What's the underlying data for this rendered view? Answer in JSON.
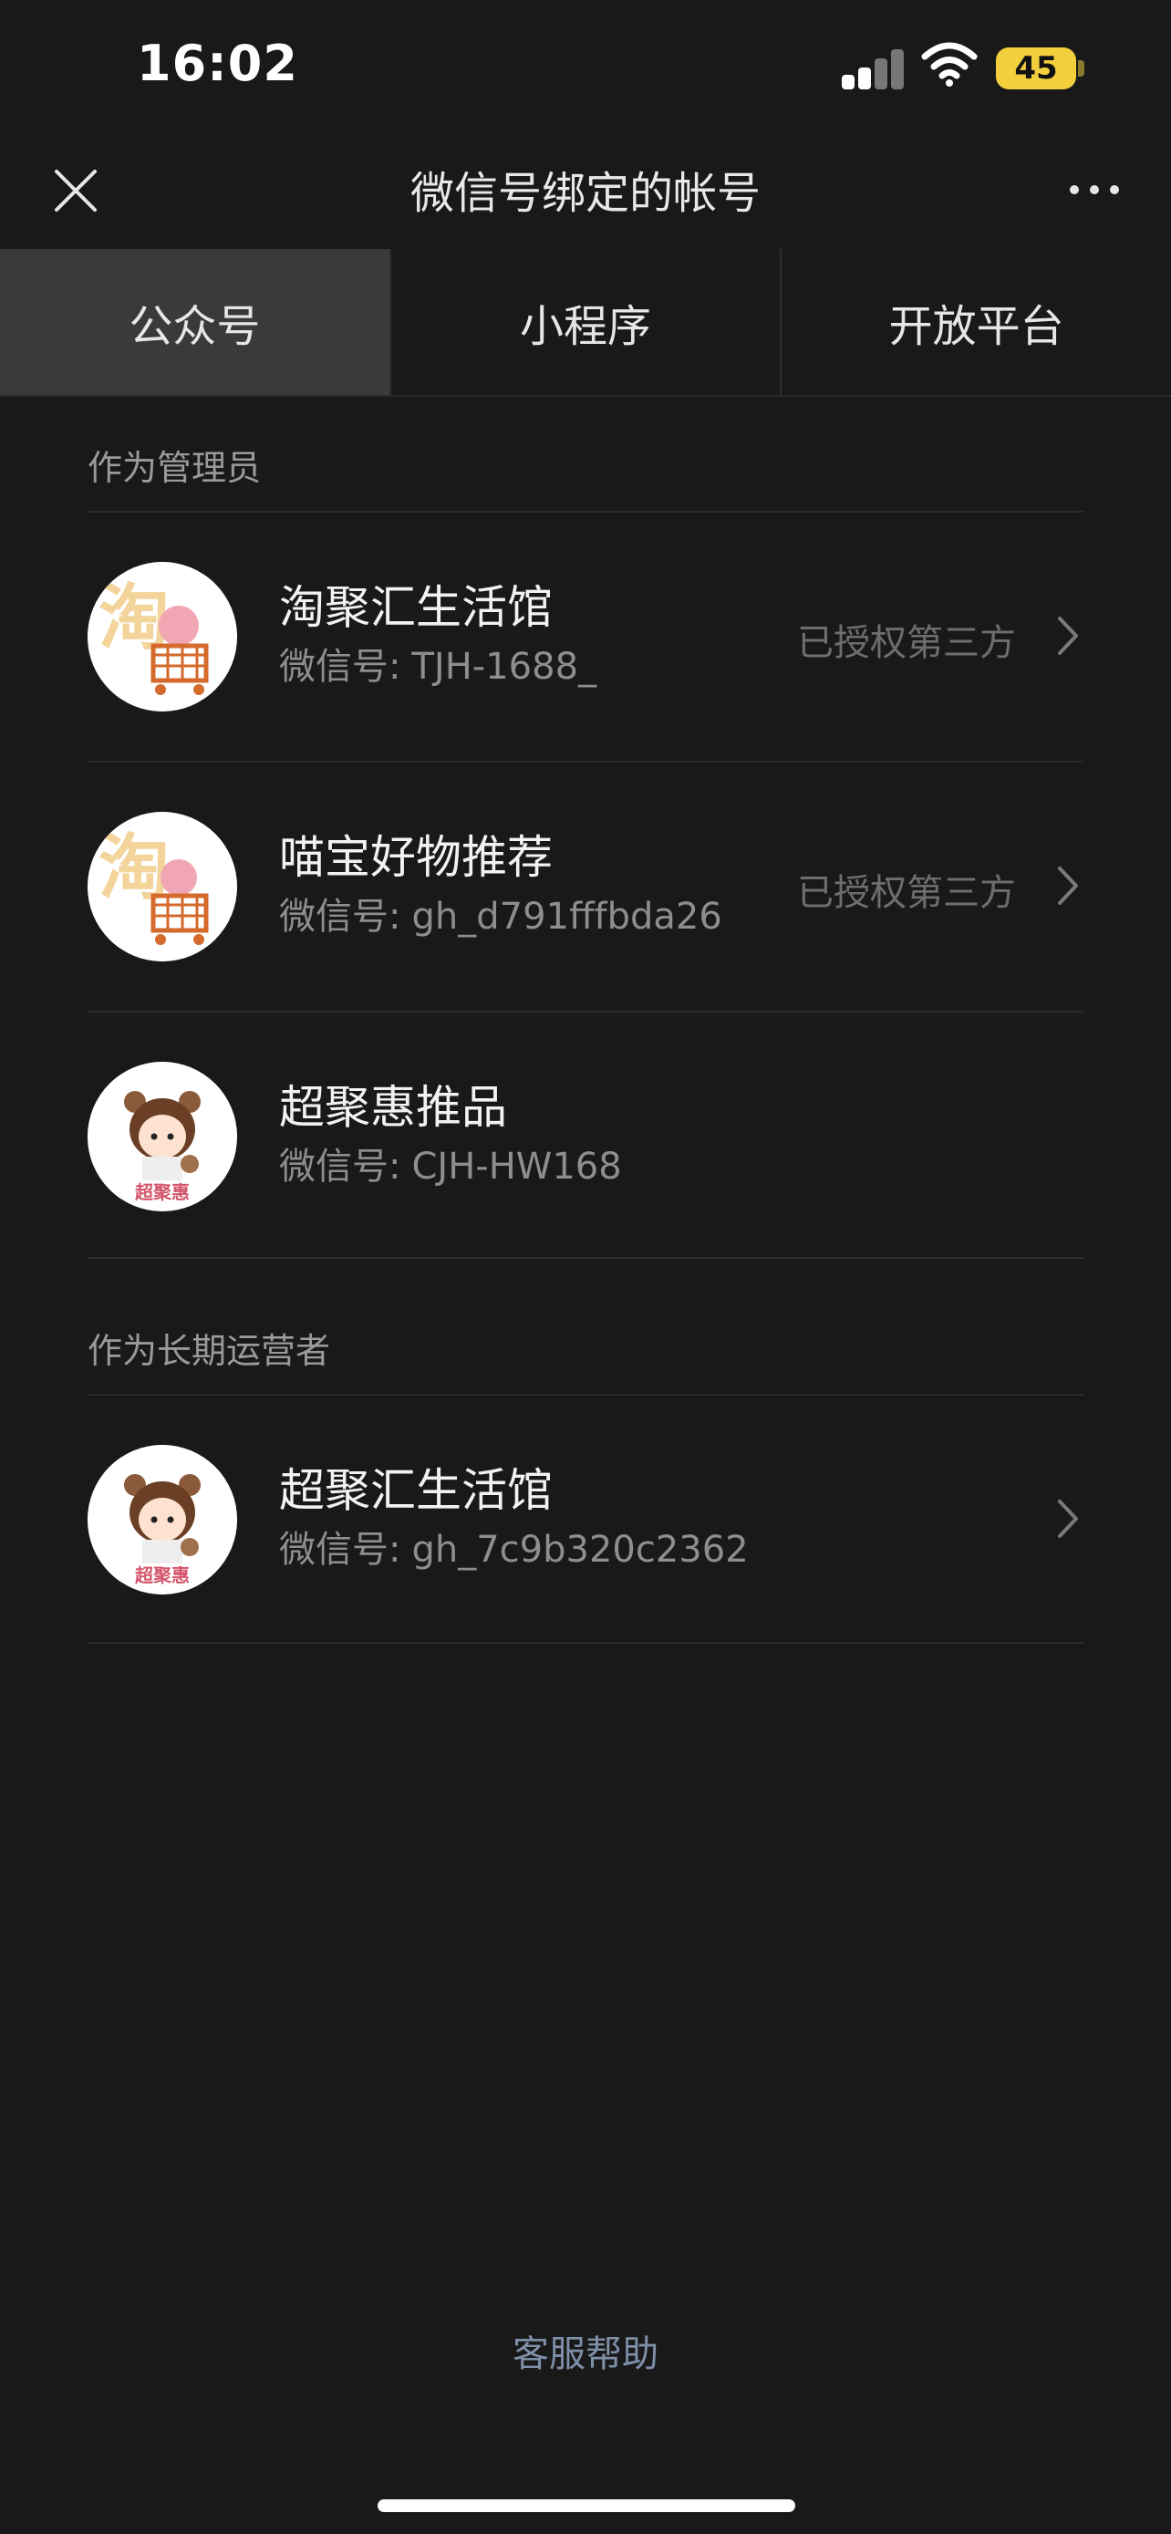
{
  "status_bar": {
    "time": "16:02",
    "battery": "45"
  },
  "nav": {
    "title": "微信号绑定的帐号"
  },
  "tabs": [
    {
      "label": "公众号",
      "active": true
    },
    {
      "label": "小程序",
      "active": false
    },
    {
      "label": "开放平台",
      "active": false
    }
  ],
  "sections": [
    {
      "header": "作为管理员",
      "items": [
        {
          "name": "淘聚汇生活馆",
          "id_label": "微信号:",
          "id": "TJH-1688_",
          "status": "已授权第三方",
          "avatar": "tao-cart-logo"
        },
        {
          "name": "喵宝好物推荐",
          "id_label": "微信号:",
          "id": "gh_d791fffbda26",
          "status": "已授权第三方",
          "avatar": "tao-cart-logo"
        },
        {
          "name": "超聚惠推品",
          "id_label": "微信号:",
          "id": "CJH-HW168",
          "status": "",
          "avatar": "girl-bear-logo"
        }
      ]
    },
    {
      "header": "作为长期运营者",
      "items": [
        {
          "name": "超聚汇生活馆",
          "id_label": "微信号:",
          "id": "gh_7c9b320c2362",
          "status": "",
          "avatar": "girl-bear-logo"
        }
      ]
    }
  ],
  "footer": {
    "help_label": "客服帮助"
  },
  "logo_text": {
    "tao": "淘",
    "cjh": "超聚惠"
  },
  "colors": {
    "background": "#191919",
    "battery": "#f2cf3c",
    "link": "#7e8fa8"
  }
}
